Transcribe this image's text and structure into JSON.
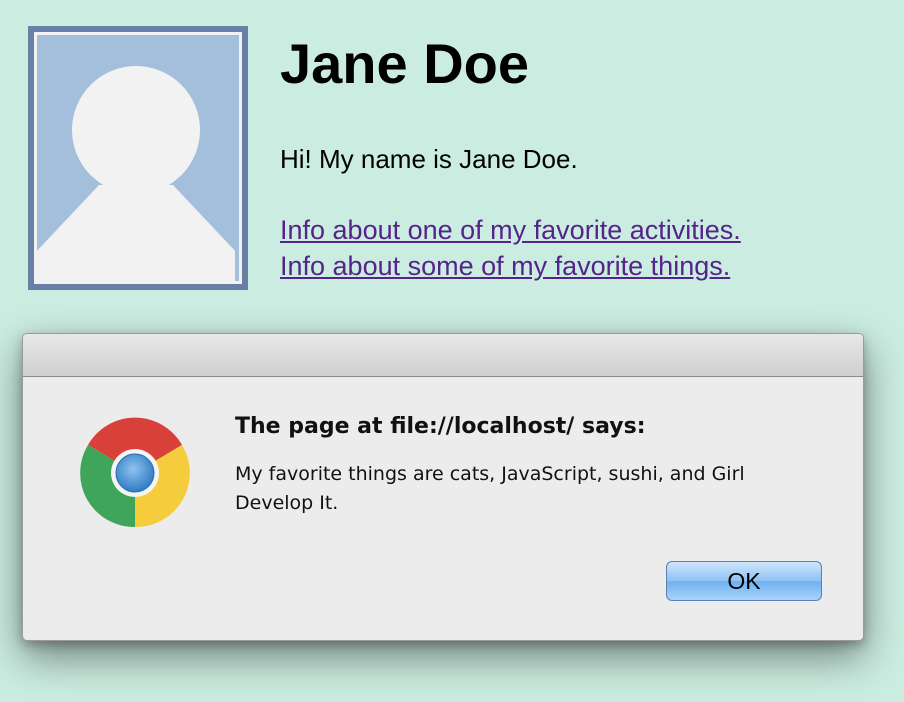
{
  "profile": {
    "avatar_icon": "default-avatar-icon",
    "name": "Jane Doe",
    "intro": "Hi! My name is Jane Doe.",
    "links": [
      {
        "label": "Info about one of my favorite activities."
      },
      {
        "label": "Info about some of my favorite things."
      }
    ]
  },
  "dialog": {
    "icon": "chrome-logo-icon",
    "heading": "The page at file://localhost/ says:",
    "message": "My favorite things are cats, JavaScript, sushi, and Girl Develop It.",
    "ok_label": "OK"
  },
  "colors": {
    "background": "#cbece0",
    "link": "#55238a",
    "button_blue": "#8ec1f3"
  }
}
